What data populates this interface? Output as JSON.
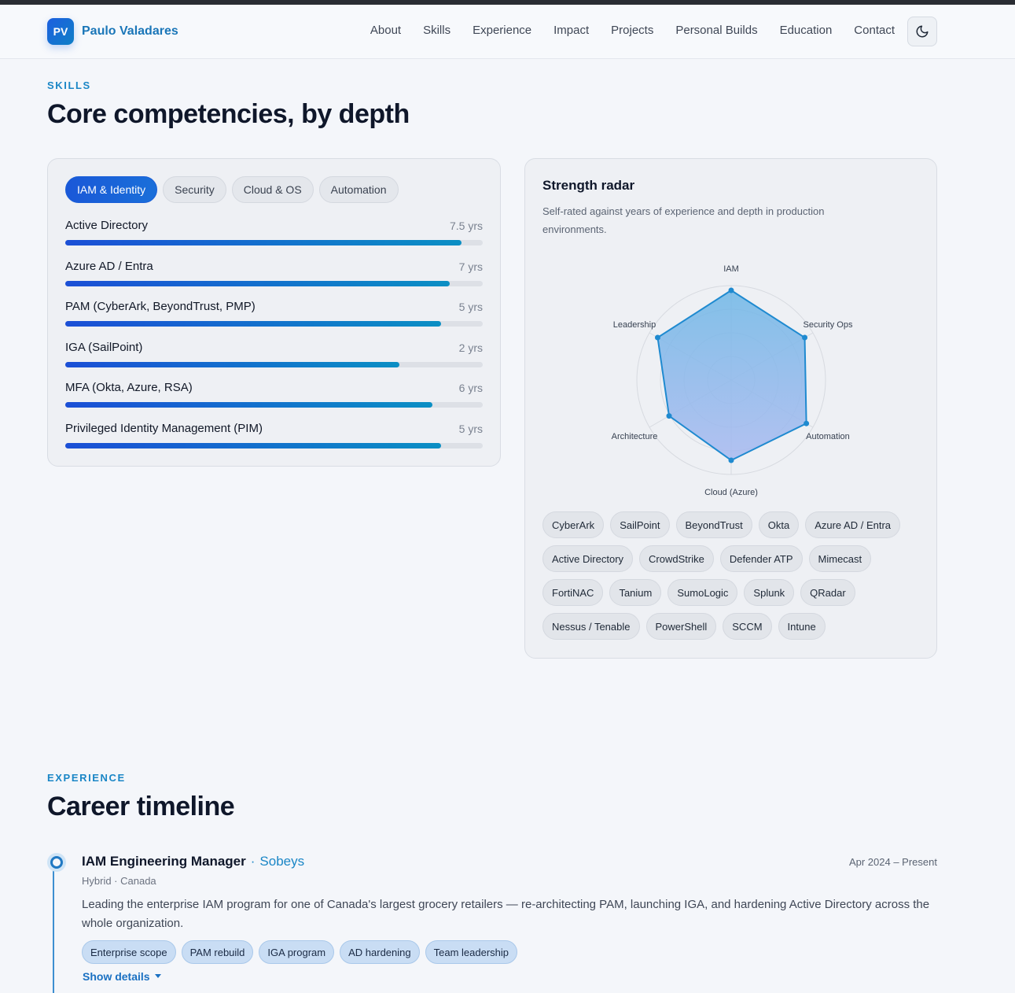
{
  "brand": {
    "initials": "PV",
    "name": "Paulo Valadares"
  },
  "nav": [
    "About",
    "Skills",
    "Experience",
    "Impact",
    "Projects",
    "Personal Builds",
    "Education",
    "Contact"
  ],
  "theme_toggle_icon": "moon-icon",
  "skills_section": {
    "eyebrow": "SKILLS",
    "title": "Core competencies, by depth",
    "tabs": [
      "IAM & Identity",
      "Security",
      "Cloud & OS",
      "Automation"
    ],
    "active_tab": "IAM & Identity",
    "items": [
      {
        "name": "Active Directory",
        "years": "7.5 yrs",
        "level": 0.95
      },
      {
        "name": "Azure AD / Entra",
        "years": "7 yrs",
        "level": 0.92
      },
      {
        "name": "PAM (CyberArk, BeyondTrust, PMP)",
        "years": "5 yrs",
        "level": 0.9
      },
      {
        "name": "IGA (SailPoint)",
        "years": "2 yrs",
        "level": 0.8
      },
      {
        "name": "MFA (Okta, Azure, RSA)",
        "years": "6 yrs",
        "level": 0.88
      },
      {
        "name": "Privileged Identity Management (PIM)",
        "years": "5 yrs",
        "level": 0.9
      }
    ]
  },
  "radar": {
    "title": "Strength radar",
    "subtitle": "Self-rated against years of experience and depth in production environments.",
    "chips": [
      "CyberArk",
      "SailPoint",
      "BeyondTrust",
      "Okta",
      "Azure AD / Entra",
      "Active Directory",
      "CrowdStrike",
      "Defender ATP",
      "Mimecast",
      "FortiNAC",
      "Tanium",
      "SumoLogic",
      "Splunk",
      "QRadar",
      "Nessus / Tenable",
      "PowerShell",
      "SCCM",
      "Intune"
    ]
  },
  "chart_data": {
    "type": "radar",
    "categories": [
      "IAM",
      "Security Ops",
      "Automation",
      "Cloud (Azure)",
      "Architecture",
      "Leadership"
    ],
    "values": [
      95,
      90,
      92,
      85,
      76,
      90
    ],
    "ylim": [
      0,
      100
    ],
    "grid": true,
    "colors": {
      "stroke": "#1f8ad0",
      "fill_top": "#6fb7e6",
      "fill_bottom": "#a8b9f0"
    }
  },
  "experience_section": {
    "eyebrow": "EXPERIENCE",
    "title": "Career timeline",
    "jobs": [
      {
        "role": "IAM Engineering Manager",
        "separator": "·",
        "company": "Sobeys",
        "date": "Apr 2024 – Present",
        "location": "Hybrid · Canada",
        "description": "Leading the enterprise IAM program for one of Canada's largest grocery retailers — re-architecting PAM, launching IGA, and hardening Active Directory across the whole organization.",
        "tags": [
          "Enterprise scope",
          "PAM rebuild",
          "IGA program",
          "AD hardening",
          "Team leadership"
        ],
        "toggle_label": "Show details"
      }
    ]
  }
}
